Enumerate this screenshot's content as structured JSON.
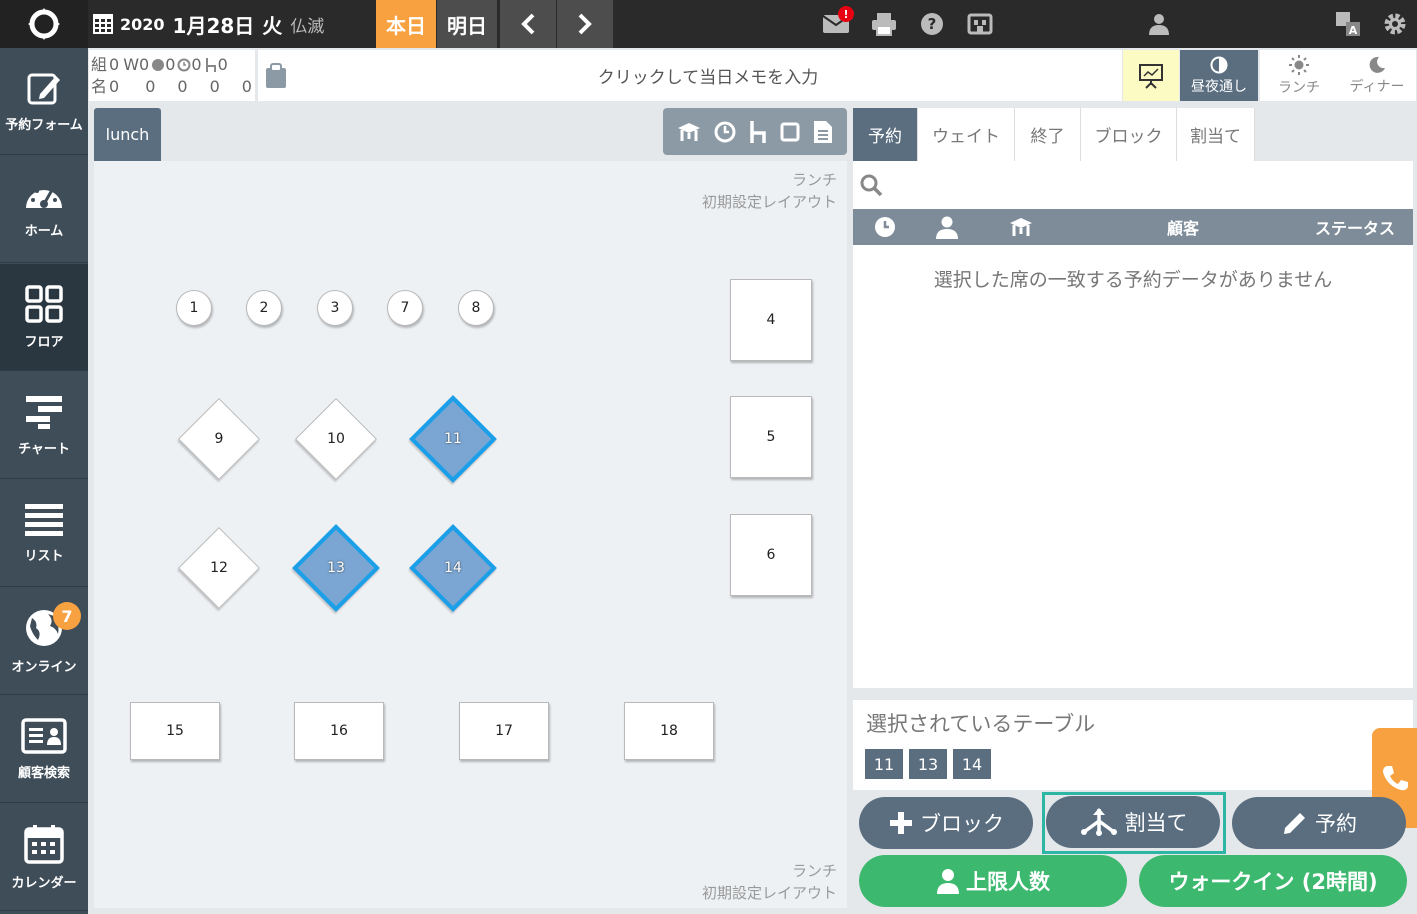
{
  "header": {
    "year": "2020",
    "month_day": "1月28日",
    "weekday": "火",
    "rokuyo": "仏滅",
    "today_label": "本日",
    "tomorrow_label": "明日",
    "mail_badge": "!"
  },
  "sidebar": {
    "items": [
      {
        "label": "予約フォーム",
        "icon": "edit-icon"
      },
      {
        "label": "ホーム",
        "icon": "dashboard-icon"
      },
      {
        "label": "フロア",
        "icon": "grid-icon"
      },
      {
        "label": "チャート",
        "icon": "chart-icon"
      },
      {
        "label": "リスト",
        "icon": "list-icon"
      },
      {
        "label": "オンライン",
        "icon": "globe-icon",
        "badge": "7"
      },
      {
        "label": "顧客検索",
        "icon": "id-card-icon"
      },
      {
        "label": "カレンダー",
        "icon": "calendar-icon"
      }
    ]
  },
  "counts": {
    "row1": {
      "kumi_label": "組",
      "kumi": "0",
      "w_label": "W",
      "w": "0",
      "online": "0",
      "time": "0",
      "chair": "0"
    },
    "row2": {
      "mei_label": "名",
      "mei": "0",
      "w": "0",
      "online": "0",
      "time": "0",
      "chair": "0"
    }
  },
  "memo": {
    "placeholder": "クリックして当日メモを入力"
  },
  "modes": [
    {
      "label": "昼夜通し",
      "active": true
    },
    {
      "label": "ランチ",
      "active": false
    },
    {
      "label": "ディナー",
      "active": false
    }
  ],
  "floor": {
    "tab": "lunch",
    "label_line1": "ランチ",
    "label_line2": "初期設定レイアウト",
    "seats": {
      "s1": "1",
      "s2": "2",
      "s3": "3",
      "s7": "7",
      "s8": "8",
      "s4": "4",
      "s5": "5",
      "s6": "6",
      "s9": "9",
      "s10": "10",
      "s11": "11",
      "s12": "12",
      "s13": "13",
      "s14": "14",
      "s15": "15",
      "s16": "16",
      "s17": "17",
      "s18": "18"
    }
  },
  "right": {
    "tabs": [
      "予約",
      "ウェイト",
      "終了",
      "ブロック",
      "割当て"
    ],
    "table_headers": {
      "customer": "顧客",
      "status": "ステータス"
    },
    "empty_message": "選択した席の一致する予約データがありません",
    "selected_title": "選択されているテーブル",
    "selected_tables": [
      "11",
      "13",
      "14"
    ]
  },
  "actions": {
    "block": "ブロック",
    "assign": "割当て",
    "reserve": "予約",
    "capacity": "上限人数",
    "walkin": "ウォークイン (2時間)"
  }
}
